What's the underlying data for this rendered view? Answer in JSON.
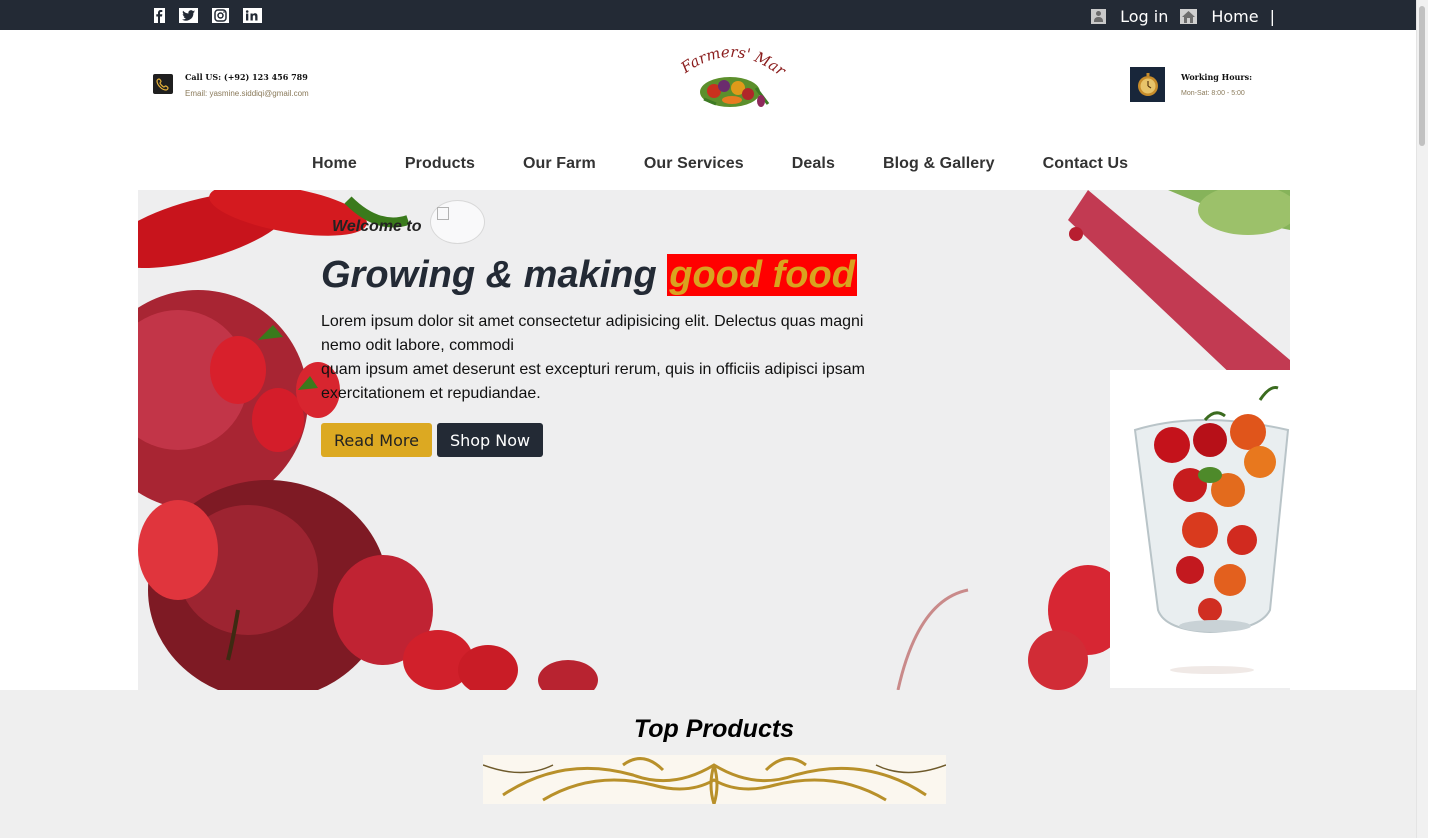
{
  "topbar": {
    "social_icons": [
      "facebook-icon",
      "twitter-icon",
      "instagram-icon",
      "linkedin-icon"
    ],
    "login_label": "Log in",
    "home_label": "Home",
    "separator": "|"
  },
  "header": {
    "call_label": "Call US: (+92) 123 456 789",
    "email_label": "Email: yasmine.siddiqi@gmail.com",
    "logo_text": "Farmers' Market",
    "hours_title": "Working Hours:",
    "hours_value": "Mon-Sat: 8:00 - 5:00"
  },
  "nav": {
    "items": [
      "Home",
      "Products",
      "Our Farm",
      "Our Services",
      "Deals",
      "Blog & Gallery",
      "Contact Us"
    ]
  },
  "hero": {
    "welcome": "Welcome to",
    "headline_main": "Growing & making ",
    "headline_highlight": "good food",
    "lead_line1": "Lorem ipsum dolor sit amet consectetur adipisicing elit. Delectus quas magni nemo odit labore, commodi",
    "lead_line2": "quam ipsum amet deserunt est excepturi rerum, quis in officiis adipisci ipsam exercitationem et repudiandae.",
    "read_more": "Read More",
    "shop_now": "Shop Now"
  },
  "products": {
    "title": "Top Products"
  },
  "colors": {
    "topbar": "#232a35",
    "accent_gold": "#dca922",
    "highlight_bg": "#ff0000",
    "section_bg": "#efefef"
  }
}
